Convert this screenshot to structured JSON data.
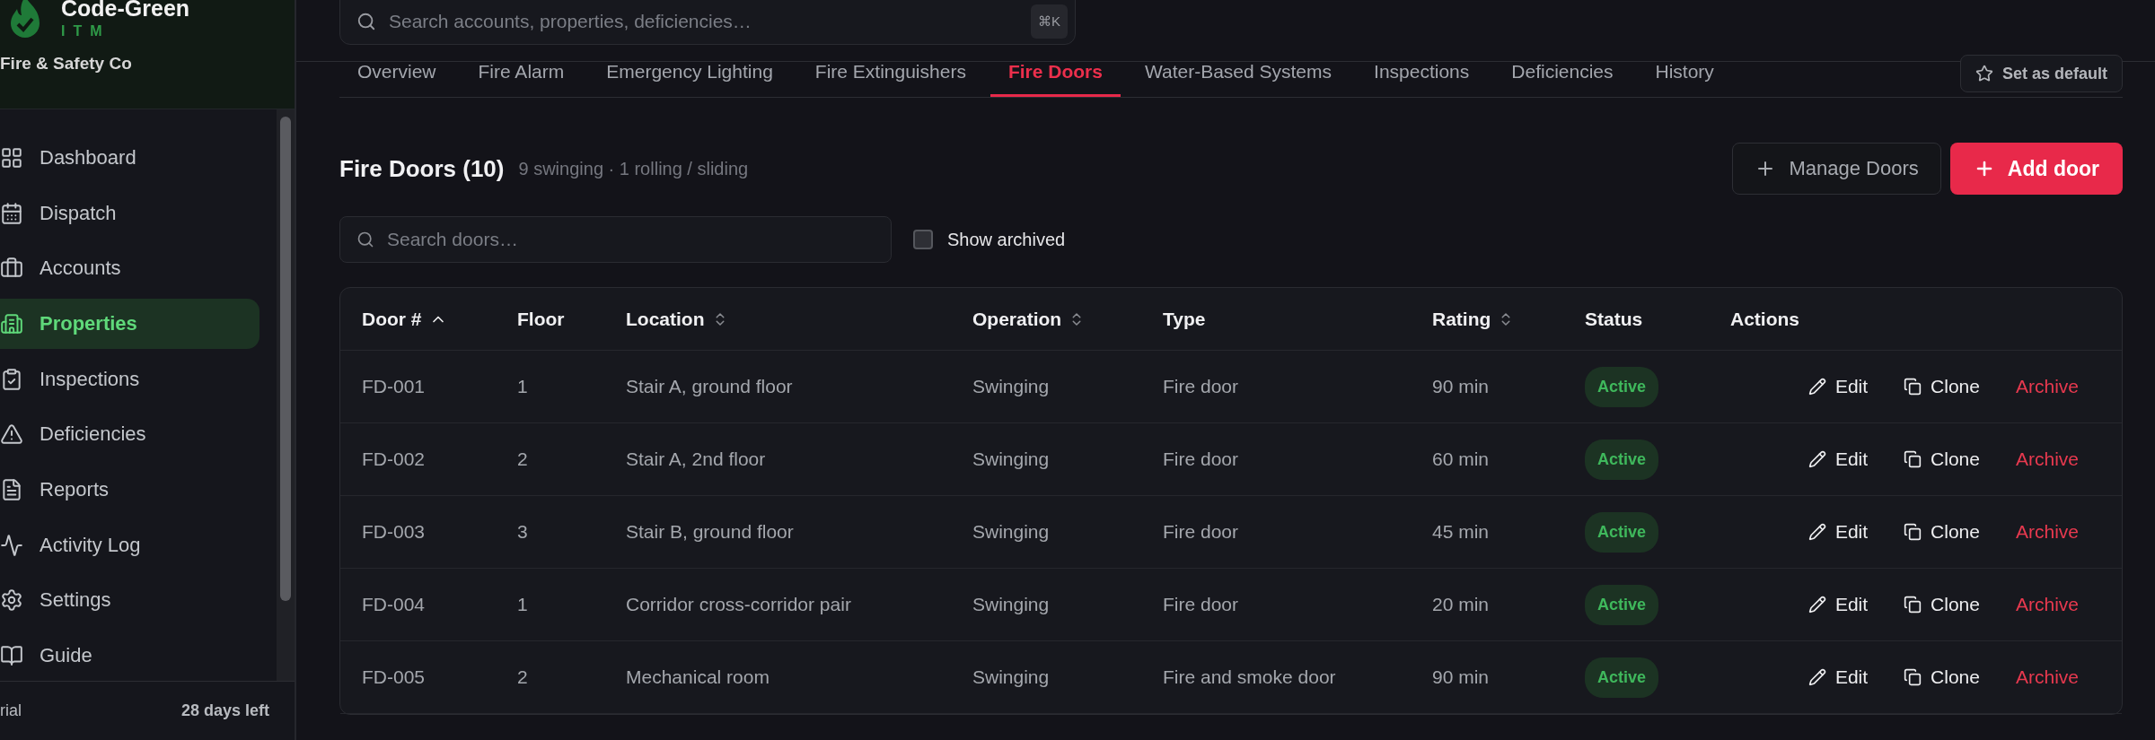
{
  "brand": {
    "name": "Code-Green",
    "tagline": "ITM",
    "org": "Fire & Safety Co"
  },
  "sidebar": {
    "items": [
      {
        "label": "Dashboard",
        "selected": false
      },
      {
        "label": "Dispatch",
        "selected": false
      },
      {
        "label": "Accounts",
        "selected": false
      },
      {
        "label": "Properties",
        "selected": true
      },
      {
        "label": "Inspections",
        "selected": false
      },
      {
        "label": "Deficiencies",
        "selected": false
      },
      {
        "label": "Reports",
        "selected": false
      },
      {
        "label": "Activity Log",
        "selected": false
      },
      {
        "label": "Settings",
        "selected": false
      },
      {
        "label": "Guide",
        "selected": false
      }
    ],
    "footer": {
      "plan": "rial",
      "days_left": "28 days left"
    }
  },
  "search": {
    "placeholder": "Search accounts, properties, deficiencies…",
    "shortcut": "⌘K"
  },
  "tabs": [
    {
      "label": "Overview",
      "selected": false
    },
    {
      "label": "Fire Alarm",
      "selected": false
    },
    {
      "label": "Emergency Lighting",
      "selected": false
    },
    {
      "label": "Fire Extinguishers",
      "selected": false
    },
    {
      "label": "Fire Doors",
      "selected": true
    },
    {
      "label": "Water-Based Systems",
      "selected": false
    },
    {
      "label": "Inspections",
      "selected": false
    },
    {
      "label": "Deficiencies",
      "selected": false
    },
    {
      "label": "History",
      "selected": false
    }
  ],
  "set_default": "Set as default",
  "section": {
    "title": "Fire Doors (10)",
    "summary": "9 swinging · 1 rolling / sliding",
    "manage_button": "Manage Doors",
    "add_button": "Add door"
  },
  "filter": {
    "placeholder": "Search doors…",
    "show_archived": {
      "label": "Show archived",
      "checked": false
    }
  },
  "table": {
    "columns": [
      {
        "label": "Door #",
        "kind": "sorted"
      },
      {
        "label": "Floor",
        "kind": "plain"
      },
      {
        "label": "Location",
        "kind": "sortable"
      },
      {
        "label": "Operation",
        "kind": "sortable"
      },
      {
        "label": "Type",
        "kind": "plain"
      },
      {
        "label": "Rating",
        "kind": "sortable"
      },
      {
        "label": "Status",
        "kind": "plain"
      },
      {
        "label": "Actions",
        "kind": "plain"
      }
    ],
    "rows": [
      {
        "door": "FD-001",
        "floor": "1",
        "location": "Stair A, ground floor",
        "operation": "Swinging",
        "type": "Fire door",
        "rating": "90 min",
        "status": "Active",
        "actions": [
          "Edit",
          "Clone",
          "Archive"
        ]
      },
      {
        "door": "FD-002",
        "floor": "2",
        "location": "Stair A, 2nd floor",
        "operation": "Swinging",
        "type": "Fire door",
        "rating": "60 min",
        "status": "Active",
        "actions": [
          "Edit",
          "Clone",
          "Archive"
        ]
      },
      {
        "door": "FD-003",
        "floor": "3",
        "location": "Stair B, ground floor",
        "operation": "Swinging",
        "type": "Fire door",
        "rating": "45 min",
        "status": "Active",
        "actions": [
          "Edit",
          "Clone",
          "Archive"
        ]
      },
      {
        "door": "FD-004",
        "floor": "1",
        "location": "Corridor cross-corridor pair",
        "operation": "Swinging",
        "type": "Fire door",
        "rating": "20 min",
        "status": "Active",
        "actions": [
          "Edit",
          "Clone",
          "Archive"
        ]
      },
      {
        "door": "FD-005",
        "floor": "2",
        "location": "Mechanical room",
        "operation": "Swinging",
        "type": "Fire and smoke door",
        "rating": "90 min",
        "status": "Active",
        "actions": [
          "Edit",
          "Clone",
          "Archive"
        ]
      }
    ]
  }
}
